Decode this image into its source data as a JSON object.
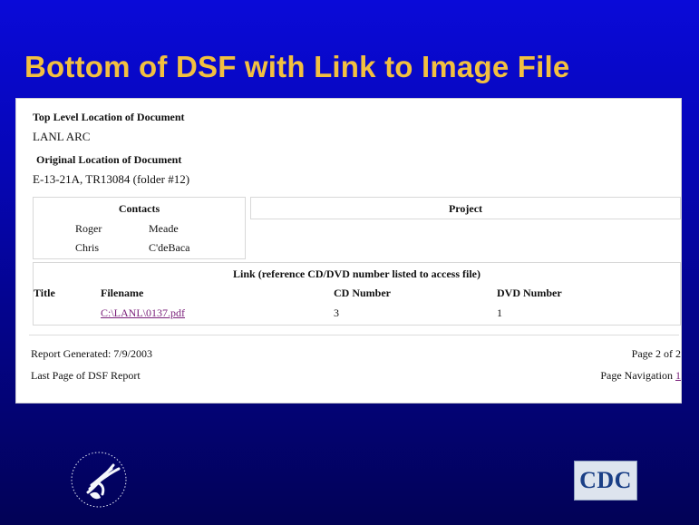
{
  "slide": {
    "title": "Bottom of DSF with Link to Image File"
  },
  "report": {
    "top_location": {
      "label": "Top Level Location of Document",
      "value": "LANL ARC"
    },
    "original_location": {
      "label": "Original Location of Document",
      "value": "E-13-21A, TR13084 (folder #12)"
    },
    "contacts": {
      "header": "Contacts",
      "rows": [
        {
          "first": "Roger",
          "last": "Meade"
        },
        {
          "first": "Chris",
          "last": "C'deBaca"
        }
      ]
    },
    "project": {
      "header": "Project"
    },
    "link_section": {
      "header": "Link (reference CD/DVD number listed to access file)",
      "columns": {
        "title": "Title",
        "filename": "Filename",
        "cd": "CD Number",
        "dvd": "DVD Number"
      },
      "row": {
        "title": "",
        "filename": "C:\\LANL\\0137.pdf",
        "cd": "3",
        "dvd": "1"
      }
    },
    "footer": {
      "generated": "Report Generated: 7/9/2003",
      "page_of": "Page 2 of 2",
      "last_page": "Last Page of DSF Report",
      "nav_label": "Page Navigation",
      "nav_link": "1"
    }
  },
  "logos": {
    "hhs": "hhs-eagle-logo",
    "cdc": {
      "text": "CDC"
    }
  }
}
